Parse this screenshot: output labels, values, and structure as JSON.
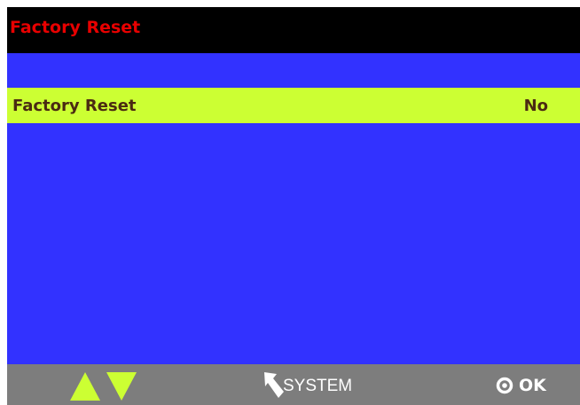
{
  "header": {
    "title": "Factory Reset",
    "title_color": "#e80000",
    "background": "#000000"
  },
  "menu": {
    "background": "#3232ff",
    "selected_color": "#ccff33",
    "items": [
      {
        "label": "Factory Reset",
        "value": "No",
        "selected": true
      }
    ]
  },
  "footer": {
    "background": "#7d7d7d",
    "nav_up_icon": "triangle-up-icon",
    "nav_down_icon": "triangle-down-icon",
    "nav_color": "#ccff33",
    "back_icon": "back-arrow-icon",
    "back_label": "SYSTEM",
    "ok_icon": "target-circle-icon",
    "ok_label": "OK"
  }
}
